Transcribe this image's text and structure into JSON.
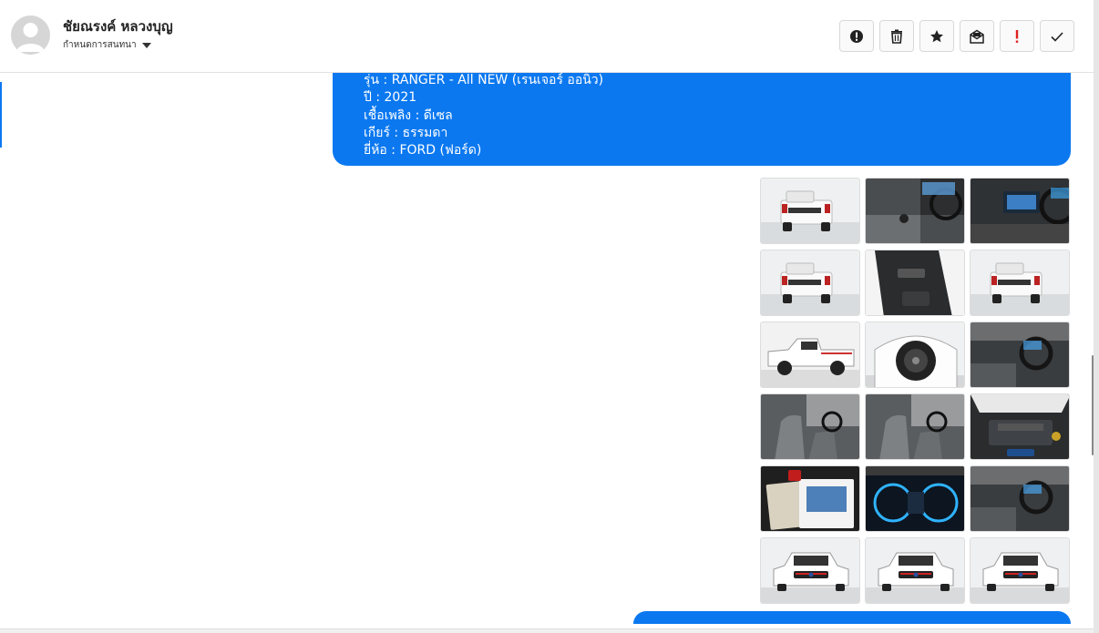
{
  "contact": {
    "name": "ชัยณรงค์ หลวงบุญ",
    "status": "กำหนดการสนทนา"
  },
  "toolbar": {
    "buttons": [
      {
        "icon": "alert-circle-icon",
        "label": "spam"
      },
      {
        "icon": "trash-icon",
        "label": "delete"
      },
      {
        "icon": "star-icon",
        "label": "star"
      },
      {
        "icon": "mail-open-icon",
        "label": "mark unread"
      },
      {
        "icon": "exclamation-icon",
        "label": "important"
      },
      {
        "icon": "check-icon",
        "label": "done"
      }
    ]
  },
  "message": {
    "lines": [
      "รุ่น : RANGER - All NEW (เรนเจอร์ ออนิว)",
      "ปี : 2021",
      "เชื้อเพลิง : ดีเซล",
      "เกียร์ : ธรรมดา",
      "ยี่ห้อ : FORD (ฟอร์ด)"
    ]
  },
  "photos": [
    {
      "scene": "truck-rear-white"
    },
    {
      "scene": "interior-gear"
    },
    {
      "scene": "interior-console"
    },
    {
      "scene": "truck-rear-white"
    },
    {
      "scene": "door-panel"
    },
    {
      "scene": "truck-rear-white"
    },
    {
      "scene": "truck-side-white"
    },
    {
      "scene": "wheel-closeup"
    },
    {
      "scene": "interior-dash"
    },
    {
      "scene": "interior-seat"
    },
    {
      "scene": "interior-seat"
    },
    {
      "scene": "engine-bay"
    },
    {
      "scene": "manual-books"
    },
    {
      "scene": "gauge-cluster"
    },
    {
      "scene": "interior-dash"
    },
    {
      "scene": "truck-front-white"
    },
    {
      "scene": "truck-front-white"
    },
    {
      "scene": "truck-front-white"
    }
  ],
  "colors": {
    "bubble": "#0b78f0",
    "accent": "#0b78f0"
  }
}
